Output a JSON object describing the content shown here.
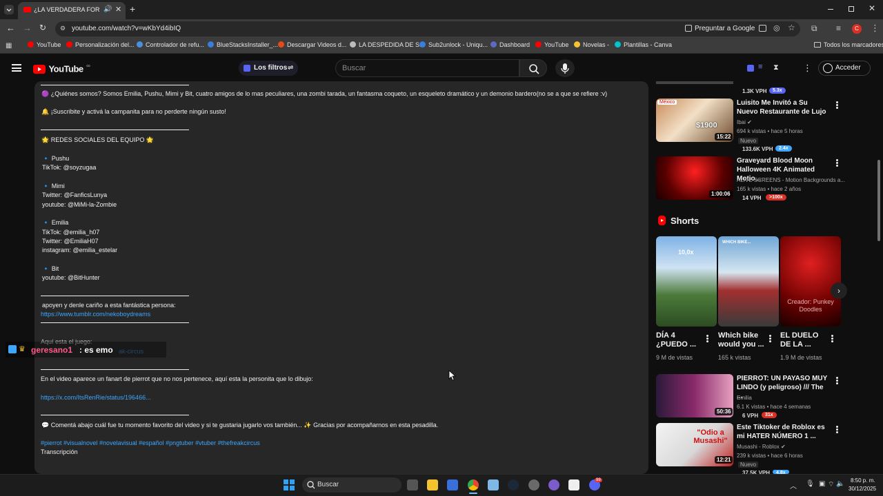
{
  "browser": {
    "tab_title": "¿LA VERDADERA FORMA D",
    "url": "youtube.com/watch?v=wKbYd4ibIQ",
    "translate_label": "Preguntar a Google",
    "profile_initial": "C",
    "bookmarks": [
      {
        "label": "YouTube",
        "color": "#ff0000"
      },
      {
        "label": "Personalización del...",
        "color": "#ff0000"
      },
      {
        "label": "Controlador de refu...",
        "color": "#4a90e2"
      },
      {
        "label": "BlueStacksInstaller_...",
        "color": "#3b7ddd"
      },
      {
        "label": "Descargar Videos d...",
        "color": "#e64a19"
      },
      {
        "label": "LA DESPEDIDA DE S...",
        "color": "#bbbbbb"
      },
      {
        "label": "Sub2unlock - Uniqu...",
        "color": "#3b7ddd"
      },
      {
        "label": "Dashboard",
        "color": "#5c6bc0"
      },
      {
        "label": "YouTube",
        "color": "#ff0000"
      },
      {
        "label": "Novelas -",
        "color": "#f4c430"
      },
      {
        "label": "Plantillas - Canva",
        "color": "#00c4cc"
      }
    ],
    "all_bookmarks": "Todos los marcadores"
  },
  "yt": {
    "logo_text": "YouTube",
    "logo_sup": "∞",
    "filters_label": "Los filtros",
    "search_placeholder": "Buscar",
    "signin_label": "Acceder"
  },
  "description": {
    "lines": [
      "🟣 ¿Quiénes somos? Somos Emilia, Pushu, Mimi y Bit, cuatro amigos de lo mas peculiares, una zombi tarada, un fantasma coqueto, un esqueleto dramático y un demonio bardero(no se a que se refiere :v)",
      "🔔 ¡Suscribite y activá la campanita para no perderte ningún susto!",
      "🌟 REDES SOCIALES DEL EQUIPO 🌟",
      "🔹 Pushu",
      "TikTok: @soyzugaa",
      "🔹 Mimi",
      "Twitter: @FanficsLunya",
      "youtube: @MiMi-la-Zombie",
      "🔹 Emilia",
      "TikTok: @emilia_h07",
      "Twitter: @EmiliaH07",
      "instagram: @emilia_estelar",
      "🔹 Bit",
      "youtube: @BitHunter",
      "apoyen y denle cariño a esta fantástica persona:",
      "https://www.tumblr.com/nekoboydreams",
      "Aquí esta el juego:",
      "ak-circus",
      "En el video aparece un fanart de pierrot que no nos pertenece, aquí esta la personita que lo dibujo:",
      "https://x.com/ItsRenRie/status/196466...",
      "💬 Comentá abajo cuál fue tu momento favorito del video y si te gustaria jugarlo vos también... ✨ Gracias por acompañarnos en esta pesadilla.",
      "#pierrot  #visualnovel  #novelavisual  #español  #pngtuber  #vtuber  #thefreakcircus",
      "Transcripción"
    ],
    "chat_user": "geresano1",
    "chat_msg": ": es emo"
  },
  "sidebar": {
    "top_partial_views": "1.3K VPH",
    "top_partial_badge": "5.3x",
    "videos": [
      {
        "title": "Luisito Me Invitó a Su Nuevo Restaurante de Lujo",
        "channel": "Ibai",
        "meta": "694 k vistas • hace 5 horas",
        "tag": "Nuevo",
        "vph": "133.6K VPH",
        "badge": "2.4x",
        "duration": "15:22",
        "thumb_overlay": "$1900",
        "flag": "México"
      },
      {
        "title": "Graveyard Blood Moon Halloween 4K Animated Motio...",
        "channel": "ALIVE SCREENS - Motion Backgrounds a...",
        "meta": "165 k vistas • hace 2 años",
        "vph": "14 VPH",
        "badge": ">100x",
        "duration": "1:00:06"
      },
      {
        "title": "PIERROT: UN PAYASO MUY LINDO (y peligroso) /// The ...",
        "channel": "Emilia",
        "meta": "6.1 K vistas • hace 4 semanas",
        "vph": "6 VPH",
        "badge": "31x",
        "duration": "50:36"
      },
      {
        "title": "Este Tiktoker de Roblox es mi HATER NÚMERO 1 ...",
        "channel": "Musashi - Roblox",
        "meta": "239 k vistas • hace 6 horas",
        "tag": "Nuevo",
        "vph": "37.5K VPH",
        "badge": "4.8x",
        "duration": "12:21",
        "thumb_overlay": "\"Odio a Musashi\""
      }
    ],
    "shorts_title": "Shorts",
    "shorts": [
      {
        "title": "DÍA 4 ¿PUEDO ...",
        "views": "9 M de vistas",
        "overlay": "10,0x"
      },
      {
        "title": "Which bike would you ...",
        "views": "165 k vistas",
        "overlay": "WHICH BIKE..."
      },
      {
        "title": "EL DUELO DE LA ...",
        "views": "1.9 M de vistas",
        "overlay": "Creador: Punkey Doodles"
      }
    ]
  },
  "taskbar": {
    "search_label": "Buscar",
    "time": "8:50 p. m.",
    "date": "30/12/2025",
    "notif_count": "99"
  },
  "colors": {
    "accent_link": "#3ea6ff",
    "vph_badge": "#5865f2",
    "yt_red": "#ff0000"
  }
}
